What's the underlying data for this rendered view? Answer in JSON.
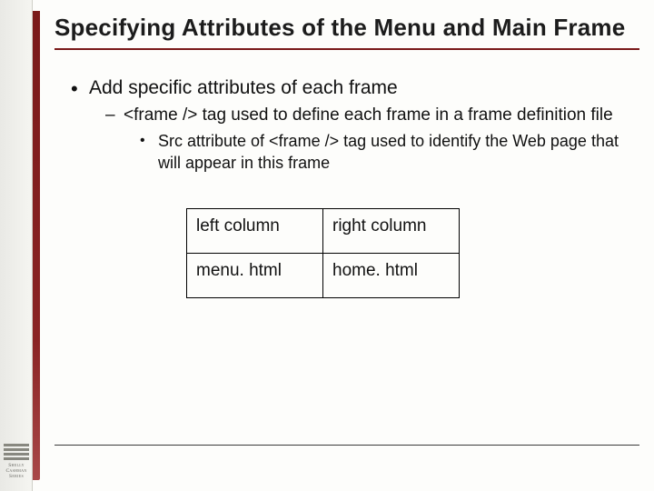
{
  "branding": {
    "line1": "Shelly",
    "line2": "Cashman",
    "line3": "Series"
  },
  "title": "Specifying Attributes of the Menu and Main Frame",
  "bullets": {
    "l1": "Add specific attributes of each frame",
    "l2": "<frame /> tag used to define each frame in a frame definition file",
    "l3": "Src attribute of <frame /> tag used to identify the Web page that will appear in this frame"
  },
  "table": {
    "headers": [
      "left column",
      "right column"
    ],
    "row": [
      "menu. html",
      "home. html"
    ]
  }
}
